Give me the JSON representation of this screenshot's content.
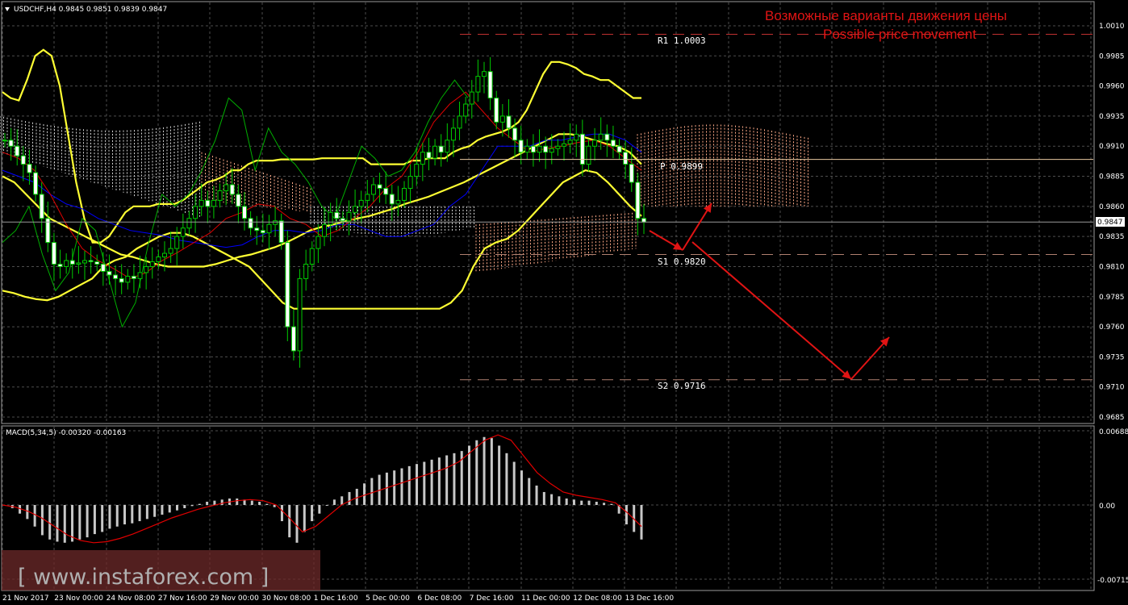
{
  "header": {
    "symbol_info": "USDCHF,H4  0.9845 0.9851 0.9839 0.9847",
    "title_ru": "Возможные варианты движения цены",
    "title_en": "Possible price movement"
  },
  "levels": {
    "r1": "R1  1.0003",
    "p": "P  0.9899",
    "s1": "S1  0.9820",
    "s2": "S2  0.9716"
  },
  "current_price": "0.9847",
  "macd": {
    "label": "MACD(5,34,5) -0.00320 -0.00163",
    "ticks": [
      "0.00688",
      "0.00",
      "-0.00715"
    ]
  },
  "watermark": "[ www.instaforex.com ]",
  "colors": {
    "background": "#000000",
    "grid": "#4d4d4d",
    "bollinger": "#ffff33",
    "candles": "#00cc00",
    "kijun": "#0000ff",
    "tenkan": "#e00000",
    "chikou": "#00b000",
    "cloud_bull": "#d8d8d8",
    "cloud_bear": "#ffaa88",
    "arrows": "#e01414",
    "macd_hist": "#c8c8c8",
    "macd_signal": "#e00000"
  },
  "chart_data": {
    "type": "candlestick",
    "symbol": "USDCHF",
    "timeframe": "H4",
    "ohlc_last": {
      "open": 0.9845,
      "high": 0.9851,
      "low": 0.9839,
      "close": 0.9847
    },
    "y_ticks": [
      "1.0010",
      "0.9985",
      "0.9960",
      "0.9935",
      "0.9910",
      "0.9885",
      "0.9860",
      "0.9835",
      "0.9810",
      "0.9785",
      "0.9760",
      "0.9735",
      "0.9710",
      "0.9685"
    ],
    "ylim": [
      0.9675,
      1.002
    ],
    "x_ticks": [
      "21 Nov 2017",
      "23 Nov 00:00",
      "24 Nov 08:00",
      "27 Nov 16:00",
      "29 Nov 00:00",
      "30 Nov 08:00",
      "1 Dec 16:00",
      "5 Dec 00:00",
      "6 Dec 08:00",
      "7 Dec 16:00",
      "11 Dec 00:00",
      "12 Dec 08:00",
      "13 Dec 16:00"
    ],
    "closes": [
      0.9915,
      0.991,
      0.9902,
      0.9895,
      0.9888,
      0.987,
      0.985,
      0.983,
      0.9812,
      0.981,
      0.9815,
      0.9812,
      0.9813,
      0.9815,
      0.9814,
      0.9812,
      0.9806,
      0.9803,
      0.98,
      0.9797,
      0.9802,
      0.98,
      0.9805,
      0.981,
      0.9814,
      0.9818,
      0.9821,
      0.9825,
      0.9835,
      0.9842,
      0.985,
      0.986,
      0.9865,
      0.986,
      0.9865,
      0.9873,
      0.9878,
      0.987,
      0.986,
      0.985,
      0.9842,
      0.984,
      0.9838,
      0.9845,
      0.9848,
      0.983,
      0.976,
      0.974,
      0.98,
      0.9812,
      0.9825,
      0.9835,
      0.9845,
      0.9855,
      0.985,
      0.9848,
      0.9855,
      0.986,
      0.9865,
      0.987,
      0.9878,
      0.9875,
      0.987,
      0.9862,
      0.9865,
      0.9875,
      0.9885,
      0.9895,
      0.9905,
      0.99,
      0.991,
      0.9905,
      0.9915,
      0.9925,
      0.9935,
      0.9945,
      0.9955,
      0.9968,
      0.9972,
      0.995,
      0.993,
      0.9935,
      0.9925,
      0.9915,
      0.9905,
      0.991,
      0.9905,
      0.991,
      0.9905,
      0.9908,
      0.991,
      0.9912,
      0.9915,
      0.992,
      0.9895,
      0.991,
      0.9915,
      0.992,
      0.9915,
      0.991,
      0.9905,
      0.9895,
      0.988,
      0.985,
      0.9847
    ],
    "pivot_levels": [
      {
        "name": "R1",
        "value": 1.0003
      },
      {
        "name": "P",
        "value": 0.9899
      },
      {
        "name": "S1",
        "value": 0.982
      },
      {
        "name": "S2",
        "value": 0.9716
      }
    ],
    "bollinger_upper": [
      0.9955,
      0.995,
      0.9948,
      0.9965,
      0.9985,
      0.999,
      0.9985,
      0.996,
      0.992,
      0.988,
      0.985,
      0.983,
      0.983,
      0.9835,
      0.9845,
      0.9855,
      0.986,
      0.986,
      0.986,
      0.9862,
      0.9862,
      0.9862,
      0.9865,
      0.987,
      0.9875,
      0.988,
      0.9882,
      0.9885,
      0.989,
      0.989,
      0.9895,
      0.9898,
      0.9898,
      0.9898,
      0.9899,
      0.9899,
      0.9899,
      0.9899,
      0.9899,
      0.99,
      0.99,
      0.99,
      0.99,
      0.99,
      0.99,
      0.9895,
      0.9895,
      0.9895,
      0.9895,
      0.9895,
      0.9898,
      0.9898,
      0.99,
      0.99,
      0.99,
      0.9905,
      0.9908,
      0.991,
      0.9915,
      0.9918,
      0.992,
      0.9922,
      0.9925,
      0.993,
      0.994,
      0.9955,
      0.997,
      0.998,
      0.998,
      0.9978,
      0.9975,
      0.997,
      0.9968,
      0.9965,
      0.9965,
      0.996,
      0.9955,
      0.995,
      0.995
    ],
    "bollinger_middle": [
      0.9885,
      0.988,
      0.987,
      0.986,
      0.985,
      0.9845,
      0.984,
      0.9835,
      0.983,
      0.9825,
      0.982,
      0.9818,
      0.9815,
      0.9812,
      0.981,
      0.981,
      0.981,
      0.981,
      0.9812,
      0.9815,
      0.9818,
      0.982,
      0.9823,
      0.9826,
      0.983,
      0.9835,
      0.984,
      0.9843,
      0.9845,
      0.9848,
      0.985,
      0.9852,
      0.9855,
      0.9858,
      0.9862,
      0.9865,
      0.9868,
      0.9872,
      0.9876,
      0.988,
      0.9885,
      0.989,
      0.9895,
      0.99,
      0.9905,
      0.991,
      0.9915,
      0.992,
      0.992,
      0.9918,
      0.9915,
      0.9912,
      0.991,
      0.9905,
      0.9895
    ],
    "bollinger_lower": [
      0.979,
      0.9788,
      0.9785,
      0.9783,
      0.9782,
      0.9785,
      0.979,
      0.9795,
      0.98,
      0.981,
      0.9815,
      0.9818,
      0.9825,
      0.983,
      0.9835,
      0.9838,
      0.9838,
      0.9835,
      0.983,
      0.9825,
      0.982,
      0.9815,
      0.981,
      0.98,
      0.979,
      0.978,
      0.9775,
      0.9775,
      0.9775,
      0.9775,
      0.9775,
      0.9775,
      0.9775,
      0.9775,
      0.9775,
      0.9775,
      0.9775,
      0.9775,
      0.9775,
      0.9775,
      0.978,
      0.979,
      0.981,
      0.9825,
      0.983,
      0.9833,
      0.984,
      0.985,
      0.986,
      0.987,
      0.988,
      0.9885,
      0.989,
      0.9888,
      0.988,
      0.987,
      0.986,
      0.9852
    ],
    "macd_histogram": [
      0.0,
      -0.0003,
      -0.0008,
      -0.0013,
      -0.002,
      -0.0028,
      -0.0032,
      -0.0034,
      -0.0035,
      -0.0034,
      -0.0032,
      -0.003,
      -0.0027,
      -0.0025,
      -0.0022,
      -0.002,
      -0.0018,
      -0.0017,
      -0.0015,
      -0.0013,
      -0.0011,
      -0.0009,
      -0.0007,
      -0.0005,
      -0.0003,
      -0.0001,
      0.0001,
      0.0003,
      0.0004,
      0.0005,
      0.0006,
      0.0006,
      0.0005,
      0.0004,
      0.0003,
      0.0001,
      -0.0002,
      -0.0015,
      -0.003,
      -0.0035,
      -0.0025,
      -0.0015,
      -0.0008,
      0.0,
      0.0005,
      0.0008,
      0.0012,
      0.0015,
      0.002,
      0.0025,
      0.0028,
      0.003,
      0.0032,
      0.0034,
      0.0036,
      0.0038,
      0.004,
      0.0042,
      0.0044,
      0.0046,
      0.0048,
      0.005,
      0.0055,
      0.006,
      0.0063,
      0.0062,
      0.0055,
      0.0048,
      0.004,
      0.0032,
      0.0025,
      0.0018,
      0.0012,
      0.001,
      0.0008,
      0.0006,
      0.0005,
      0.0004,
      0.0004,
      0.0003,
      0.0002,
      0.0001,
      -0.0008,
      -0.0018,
      -0.0025,
      -0.0032
    ],
    "macd_signal": [
      0.0,
      -0.0002,
      -0.0006,
      -0.0012,
      -0.002,
      -0.0028,
      -0.0033,
      -0.0035,
      -0.0034,
      -0.0031,
      -0.0027,
      -0.0022,
      -0.0017,
      -0.0012,
      -0.0008,
      -0.0004,
      -0.0001,
      0.0002,
      0.0004,
      0.0005,
      0.0004,
      0.0,
      -0.0012,
      -0.0025,
      -0.002,
      -0.001,
      0.0,
      0.0006,
      0.001,
      0.0014,
      0.0018,
      0.0022,
      0.0026,
      0.003,
      0.0034,
      0.004,
      0.005,
      0.006,
      0.0065,
      0.006,
      0.0045,
      0.003,
      0.002,
      0.0012,
      0.0009,
      0.0007,
      0.0005,
      0.0002,
      -0.0008,
      -0.002
    ]
  }
}
